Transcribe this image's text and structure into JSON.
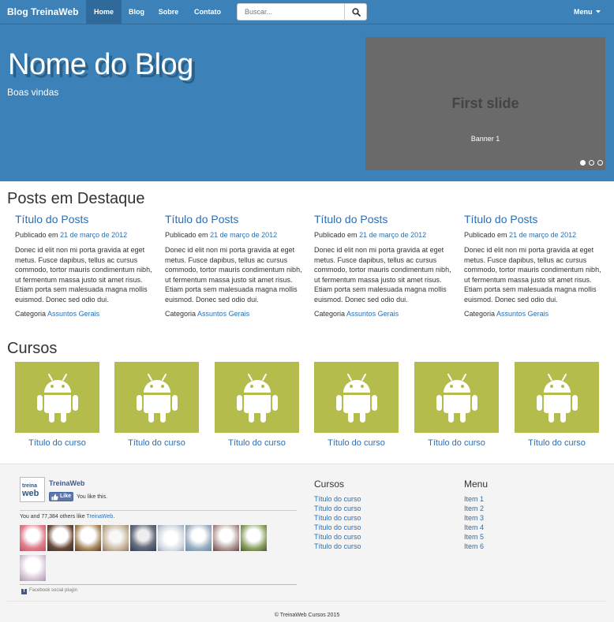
{
  "navbar": {
    "brand": "Blog TreinaWeb",
    "items": [
      "Home",
      "Blog",
      "Sobre",
      "Contato"
    ],
    "search_placeholder": "Buscar...",
    "menu_label": "Menu",
    "accent": "#3c82b8"
  },
  "hero": {
    "title": "Nome do Blog",
    "subtitle": "Boas vindas",
    "carousel": {
      "slide_title": "First slide",
      "caption": "Banner 1",
      "slide_count": 3,
      "active_index": 0
    }
  },
  "posts": {
    "heading": "Posts em Destaque",
    "items": [
      {
        "title": "Título do Posts",
        "published_prefix": "Publicado em",
        "date": "21 de março de 2012",
        "body": "Donec id elit non mi porta gravida at eget metus. Fusce dapibus, tellus ac cursus commodo, tortor mauris condimentum nibh, ut fermentum massa justo sit amet risus. Etiam porta sem malesuada magna mollis euismod. Donec sed odio dui.",
        "category_prefix": "Categoria",
        "category": "Assuntos Gerais"
      },
      {
        "title": "Título do Posts",
        "published_prefix": "Publicado em",
        "date": "21 de março de 2012",
        "body": "Donec id elit non mi porta gravida at eget metus. Fusce dapibus, tellus ac cursus commodo, tortor mauris condimentum nibh, ut fermentum massa justo sit amet risus. Etiam porta sem malesuada magna mollis euismod. Donec sed odio dui.",
        "category_prefix": "Categoria",
        "category": "Assuntos Gerais"
      },
      {
        "title": "Título do Posts",
        "published_prefix": "Publicado em",
        "date": "21 de março de 2012",
        "body": "Donec id elit non mi porta gravida at eget metus. Fusce dapibus, tellus ac cursus commodo, tortor mauris condimentum nibh, ut fermentum massa justo sit amet risus. Etiam porta sem malesuada magna mollis euismod. Donec sed odio dui.",
        "category_prefix": "Categoria",
        "category": "Assuntos Gerais"
      },
      {
        "title": "Título do Posts",
        "published_prefix": "Publicado em",
        "date": "21 de março de 2012",
        "body": "Donec id elit non mi porta gravida at eget metus. Fusce dapibus, tellus ac cursus commodo, tortor mauris condimentum nibh, ut fermentum massa justo sit amet risus. Etiam porta sem malesuada magna mollis euismod. Donec sed odio dui.",
        "category_prefix": "Categoria",
        "category": "Assuntos Gerais"
      }
    ]
  },
  "courses": {
    "heading": "Cursos",
    "icon": "android-icon",
    "tile_color": "#b4bd4c",
    "items": [
      "Título do curso",
      "Título do curso",
      "Título do curso",
      "Título do curso",
      "Título do curso",
      "Título do curso"
    ]
  },
  "footer": {
    "facebook": {
      "page_name": "TreinaWeb",
      "logo_top": "treina",
      "logo_bottom": "web",
      "like_label": "Like",
      "you_like": "You like this.",
      "others_prefix": "You and 77,384 others like ",
      "others_link": "TreinaWeb",
      "others_suffix": ".",
      "plugin_label": "Facebook social plugin",
      "fb_letter": "f"
    },
    "courses_col": {
      "heading": "Cursos",
      "links": [
        "Título do curso",
        "Título do curso",
        "Título do curso",
        "Título do curso",
        "Título do curso",
        "Título do curso"
      ]
    },
    "menu_col": {
      "heading": "Menu",
      "links": [
        "Item 1",
        "Item 2",
        "Item 3",
        "Item 4",
        "Item 5",
        "Item 6"
      ]
    },
    "copyright": "© TreinaWeb Cursos 2015"
  }
}
